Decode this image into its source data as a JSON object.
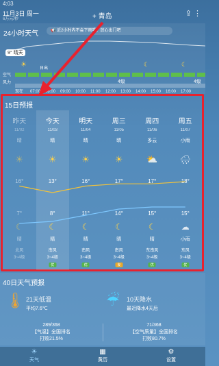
{
  "status": {
    "time": "4:03",
    "date": "11月3日 周一",
    "speed": "6万元/秒",
    "city": "青岛",
    "add": "+",
    "share_icon": "share-icon",
    "more_icon": "more-icon"
  },
  "hourly": {
    "title": "24小时天气",
    "notice": "📢 近2小时内不会下雨哦，放心出门吧",
    "temp_now": "9° 晴天",
    "now_label": "现在",
    "sunrise": "日出",
    "row_air": "空气",
    "row_wind": "风力",
    "wind_level": "4级",
    "wind_level2": "4级",
    "hours": [
      "现在",
      "07:00",
      "08:00",
      "09:00",
      "10:00",
      "11:00",
      "12:00",
      "13:00",
      "14:00",
      "15:00",
      "16:00",
      "17:00"
    ]
  },
  "forecast": {
    "title": "15日预报",
    "days": [
      {
        "wd": "昨天",
        "dt": "11/02",
        "cond": "晴",
        "icon": "sun-icon",
        "hi": "16°",
        "lo": "7°",
        "nicon": "moon-icon",
        "ncond": "晴",
        "wind": "北风",
        "wind2": "3~4级",
        "aqi": "",
        "past": true
      },
      {
        "wd": "今天",
        "dt": "11/03",
        "cond": "晴",
        "icon": "sun-icon",
        "hi": "13°",
        "lo": "8°",
        "nicon": "moon-icon",
        "ncond": "晴",
        "wind": "南风",
        "wind2": "3~4级",
        "aqi": "优",
        "aqiClass": "good"
      },
      {
        "wd": "明天",
        "dt": "11/04",
        "cond": "晴",
        "icon": "sun-icon",
        "hi": "16°",
        "lo": "11°",
        "nicon": "moon-icon",
        "ncond": "晴",
        "wind": "南风",
        "wind2": "3~4级",
        "aqi": "优",
        "aqiClass": "good"
      },
      {
        "wd": "周三",
        "dt": "11/05",
        "cond": "晴",
        "icon": "sun-icon",
        "hi": "17°",
        "lo": "14°",
        "nicon": "moon-icon",
        "ncond": "晴",
        "wind": "南风",
        "wind2": "3~4级",
        "aqi": "良",
        "aqiClass": "mid"
      },
      {
        "wd": "周四",
        "dt": "11/06",
        "cond": "多云",
        "icon": "cloud-sun-icon",
        "hi": "17°",
        "lo": "15°",
        "nicon": "moon-icon",
        "ncond": "晴",
        "wind": "东南风",
        "wind2": "3~4级",
        "aqi": "优",
        "aqiClass": "good"
      },
      {
        "wd": "周五",
        "dt": "11/07",
        "cond": "小雨",
        "icon": "rain-cloud-icon",
        "hi": "18°",
        "lo": "15°",
        "nicon": "cloud-icon",
        "ncond": "小雨",
        "wind": "东风",
        "wind2": "3~4级",
        "aqi": "优",
        "aqiClass": "good"
      }
    ]
  },
  "forty": {
    "title": "40日天气预报",
    "low_head": "21天低温",
    "low_sub": "平均7.6℃",
    "rain_head": "10天降水",
    "rain_sub": "最近降水4天后",
    "rank1_top": "289/368",
    "rank1_mid": "【气温】全国排名",
    "rank1_bot": "打败21.5%",
    "rank2_top": "71/368",
    "rank2_mid": "【空气质量】全国排名",
    "rank2_bot": "打败80.7%"
  },
  "tabs": [
    {
      "label": "天气",
      "icon": "weather-tab-icon",
      "active": true
    },
    {
      "label": "黄历",
      "icon": "almanac-tab-icon"
    },
    {
      "label": "设置",
      "icon": "settings-tab-icon"
    }
  ],
  "colors": {
    "highlight": "#e8222e",
    "accent": "#9fd6ff"
  }
}
